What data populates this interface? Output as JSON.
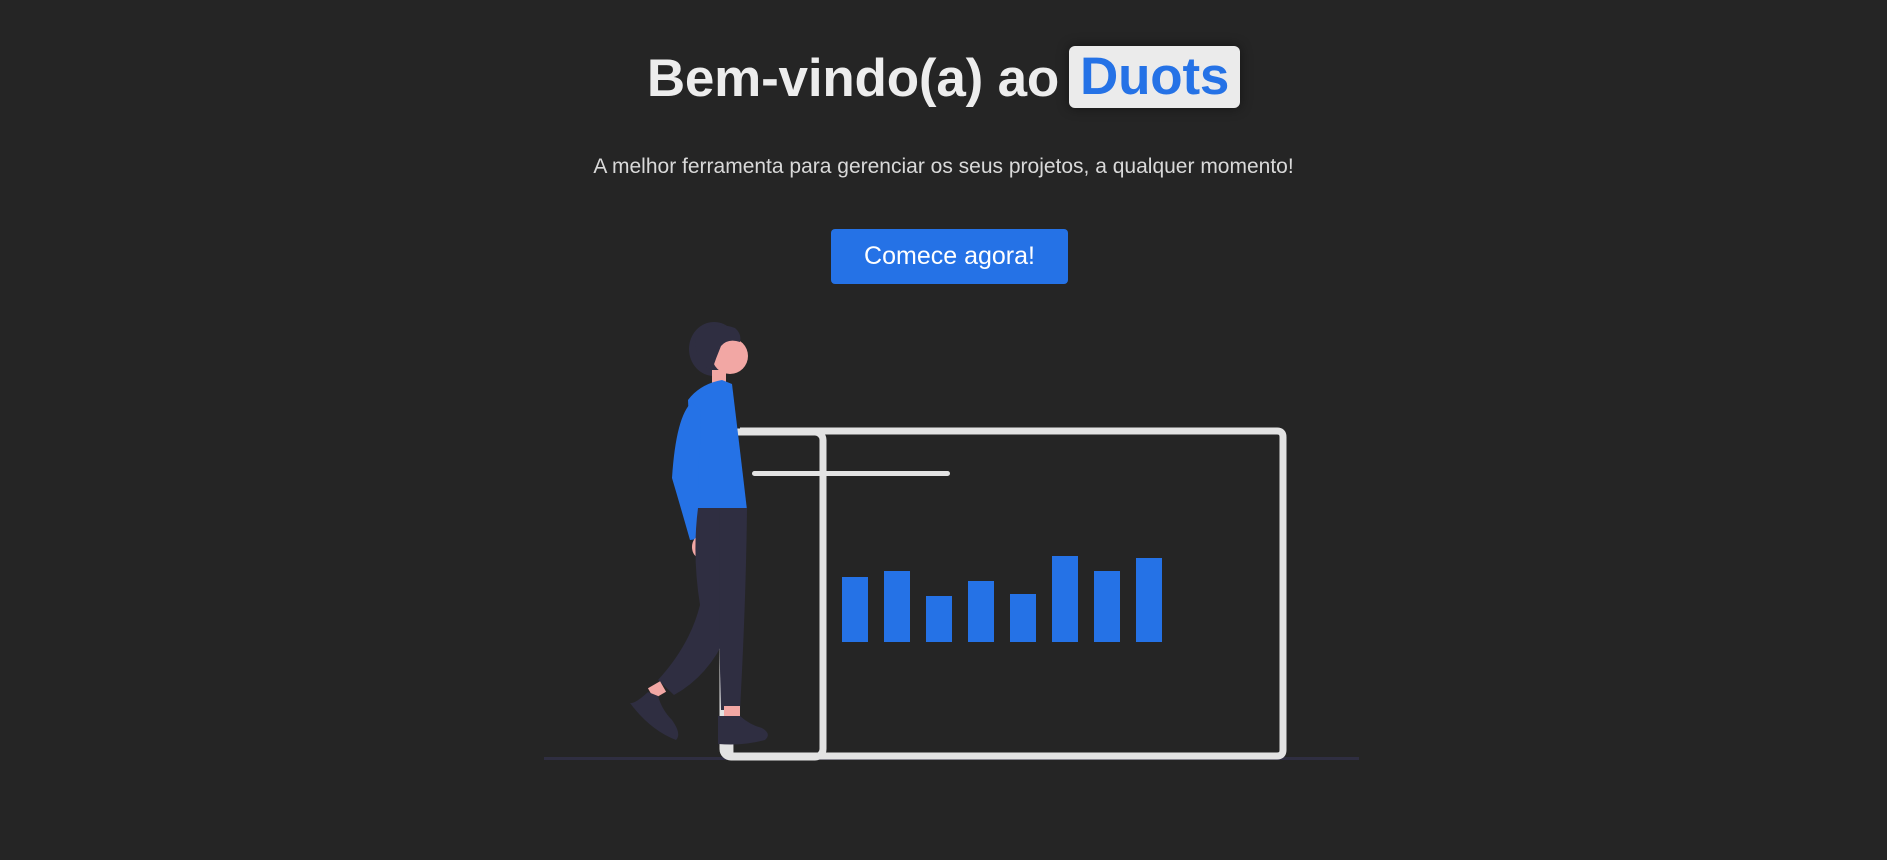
{
  "hero": {
    "title_prefix": "Bem-vindo(a) ao",
    "brand_name": "Duots",
    "subtitle": "A melhor ferramenta para gerenciar os seus projetos, a qualquer momento!"
  },
  "cta": {
    "label": "Comece agora!"
  },
  "illustration": {
    "icon": "person-presenting-chart-illustration",
    "bar_levels": [
      0.62,
      0.68,
      0.44,
      0.58,
      0.46,
      0.82,
      0.68,
      0.8
    ]
  },
  "colors": {
    "background": "#252525",
    "accent": "#2572e6",
    "title_text": "#ededed",
    "badge_background": "#ebebeb",
    "board_outline": "#e3e3e3",
    "figure_dark": "#2f2e41",
    "skin": "#f2a7a4"
  }
}
